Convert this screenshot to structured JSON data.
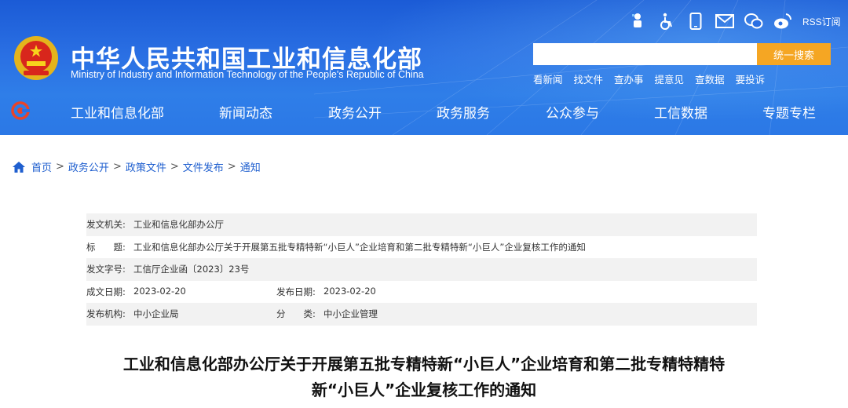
{
  "header": {
    "title": "中华人民共和国工业和信息化部",
    "subtitle": "Ministry of Industry and Information Technology of the People's Republic of China",
    "icons": [
      "accessibility-elder-icon",
      "wheelchair-icon",
      "mobile-icon",
      "mail-icon",
      "wechat-icon",
      "weibo-icon"
    ],
    "rss_label": "RSS订阅",
    "search": {
      "placeholder": "",
      "button_label": "统一搜索"
    },
    "quick_links": [
      "看新闻",
      "找文件",
      "查办事",
      "提意见",
      "查数据",
      "要投诉"
    ],
    "colors": {
      "header_blue": "#2a6fe3",
      "search_button": "#f5a623",
      "link_blue": "#1f5fcf"
    }
  },
  "nav": {
    "items": [
      "工业和信息化部",
      "新闻动态",
      "政务公开",
      "政务服务",
      "公众参与",
      "工信数据",
      "专题专栏"
    ]
  },
  "breadcrumb": [
    "首页",
    "政务公开",
    "政策文件",
    "文件发布",
    "通知"
  ],
  "meta": {
    "issuer_label": "发文机关:",
    "issuer": "工业和信息化部办公厅",
    "title_label": "标　　题:",
    "title": "工业和信息化部办公厅关于开展第五批专精特新“小巨人”企业培育和第二批专精特新“小巨人”企业复核工作的通知",
    "doc_no_label": "发文字号:",
    "doc_no": "工信厅企业函〔2023〕23号",
    "created_label": "成文日期:",
    "created": "2023-02-20",
    "published_label": "发布日期:",
    "published": "2023-02-20",
    "agency_label": "发布机构:",
    "agency": "中小企业局",
    "category_label": "分　　类:",
    "category": "中小企业管理"
  },
  "doc_title_line1": "工业和信息化部办公厅关于开展第五批专精特新“小巨人”企业培育和第二批专精特精特",
  "doc_title_line2": "新“小巨人”企业复核工作的通知"
}
